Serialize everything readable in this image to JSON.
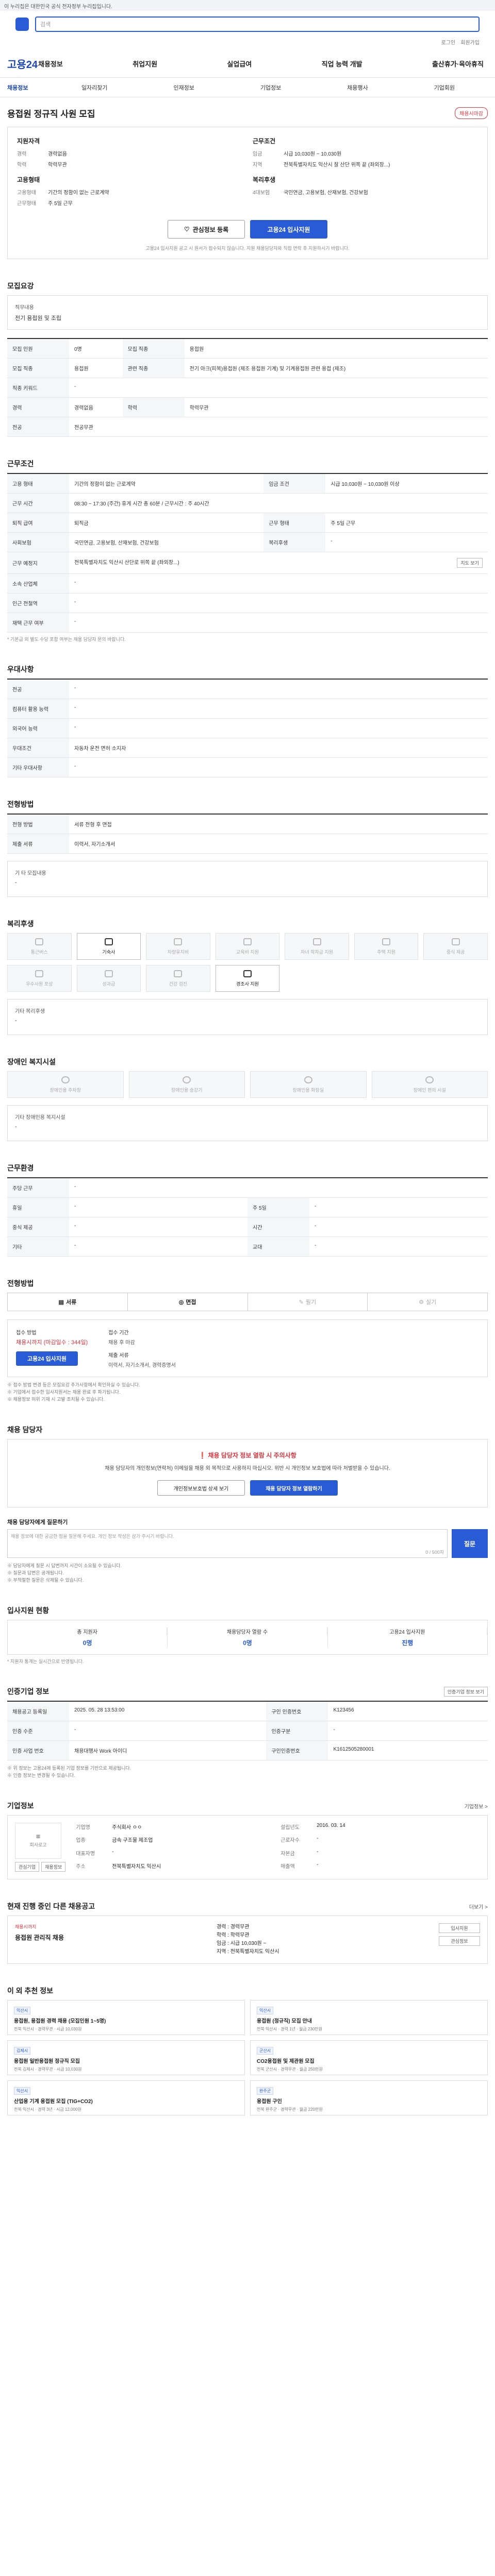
{
  "topbar": {
    "notice": "이 누리집은 대한민국 공식 전자정부 누리집입니다."
  },
  "search": {
    "placeholder": "검색"
  },
  "util": {
    "items": [
      "로그인",
      "회원가입"
    ]
  },
  "gnb": {
    "brand": "고용24",
    "menu": [
      "채용정보",
      "취업지원",
      "실업급여",
      "직업 능력 개발",
      "출산휴가·육아휴직"
    ]
  },
  "lnb": {
    "current": "채용정보",
    "items": [
      "일자리찾기",
      "인재정보",
      "기업정보",
      "채용행사",
      "기업회원"
    ]
  },
  "job": {
    "title": "용접원 정규직 사원 모집",
    "badge": "채용시마감"
  },
  "summary": {
    "left_title": "지원자격",
    "left": [
      {
        "k": "경력",
        "v": "경력없음"
      },
      {
        "k": "학력",
        "v": "학력무관"
      }
    ],
    "left2_title": "고용형태",
    "left2": [
      {
        "k": "고용형태",
        "v": "기간의 정함이 없는 근로계약"
      },
      {
        "k": "근무형태",
        "v": "주 5일 근무"
      }
    ],
    "right_title": "근무조건",
    "right": [
      {
        "k": "임금",
        "v": "시급 10,030원 ~ 10,030원"
      },
      {
        "k": "지역",
        "v": "전북특별자치도 익산시 잘 산단 위쪽 끝 (좌외장...)"
      }
    ],
    "right2_title": "복리후생",
    "right2": [
      {
        "k": "4대보험",
        "v": "국민연금, 고용보험, 산재보험, 건강보험"
      }
    ],
    "btn_scrap": "관심정보 등록",
    "btn_apply": "고용24 입사지원",
    "note": "고용24 입사지원 공고 시 원서가 접수되지 않습니다. 지원 채용담당자와 직접 연락 후 지원하시기 바랍니다."
  },
  "duty": {
    "title": "모집요강",
    "label": "직무내용",
    "value": "전기 용접원 및 조립"
  },
  "recruit": {
    "rows": [
      {
        "k1": "모집 인원",
        "v1": "0명",
        "k2": "모집 직종",
        "v2": "용접원"
      },
      {
        "k1": "모집 직종",
        "v1": "용접원",
        "k2": "관련 직종",
        "v2": "전기 아크(피복)용접원 (제조 용접원 기계) 및 기계용접원 관련 용접 (제조)"
      },
      {
        "k1": "직종 키워드",
        "v1": "-",
        "k2": "",
        "v2": ""
      },
      {
        "k1": "경력",
        "v1": "경력없음",
        "k2": "학력",
        "v2": "학력무관"
      },
      {
        "k1": "전공",
        "v1": "전공무관",
        "k2": "",
        "v2": ""
      }
    ]
  },
  "work": {
    "title": "근무조건",
    "rows": [
      {
        "k1": "고용 형태",
        "v1": "기간의 정함이 없는 근로계약",
        "k2": "임금 조건",
        "v2": "시급 10,030원 ~ 10,030원 이상"
      },
      {
        "k1": "근무 시간",
        "v1": "08:30 ~ 17:30 (주간) 휴게 시간 총 60분 / 근무시간 : 주 40시간",
        "k2": "",
        "v2": ""
      },
      {
        "k1": "퇴직 급여",
        "v1": "퇴직금",
        "k2": "근무 형태",
        "v2": "주 5일 근무"
      },
      {
        "k1": "사회보험",
        "v1": "국민연금, 고용보험, 산재보험, 건강보험",
        "k2": "복리후생",
        "v2": "-"
      },
      {
        "k1": "근무 예정지",
        "v1": "전북특별자치도 익산시 산단로 위쪽 끝 (좌외장...)",
        "k2": "",
        "v2": ""
      },
      {
        "k1": "소속 산업체",
        "v1": "-",
        "k2": "",
        "v2": ""
      },
      {
        "k1": "인근 전철역",
        "v1": "-",
        "k2": "",
        "v2": ""
      },
      {
        "k1": "재택 근무 여부",
        "v1": "-",
        "k2": "",
        "v2": ""
      }
    ],
    "map_btn": "지도 보기",
    "footnote": "* 기본급 외 별도 수당 포함 여부는 채용 담당자 문의 바랍니다."
  },
  "pref": {
    "title": "우대사항",
    "rows": [
      {
        "k": "전공",
        "v": "-"
      },
      {
        "k": "컴퓨터 활용 능력",
        "v": "-"
      },
      {
        "k": "외국어 능력",
        "v": "-"
      },
      {
        "k": "우대조건",
        "v": "자동차 운전 면허 소지자"
      },
      {
        "k": "기타 우대사항",
        "v": "-"
      }
    ]
  },
  "screen": {
    "title": "전형방법",
    "rows": [
      {
        "k": "전형 방법",
        "v": "서류 전형 후 면접"
      },
      {
        "k": "제출 서류",
        "v": "이력서, 자기소개서"
      }
    ],
    "etc_label": "기 타 모집내용",
    "etc_value": "-"
  },
  "welfare": {
    "title": "복리후생",
    "items": [
      {
        "label": "통근버스",
        "on": false
      },
      {
        "label": "기숙사",
        "on": true
      },
      {
        "label": "차량유지비",
        "on": false
      },
      {
        "label": "교육비 지원",
        "on": false
      },
      {
        "label": "자녀 학자금 지원",
        "on": false
      },
      {
        "label": "주택 지원",
        "on": false
      },
      {
        "label": "중식 제공",
        "on": false
      },
      {
        "label": "우수사원 포상",
        "on": false
      },
      {
        "label": "성과급",
        "on": false
      },
      {
        "label": "건강 검진",
        "on": false
      },
      {
        "label": "경조사 지원",
        "on": true
      }
    ],
    "etc_label": "기타 복리후생",
    "etc_value": "-"
  },
  "disabled": {
    "title": "장애인 복지시설",
    "items": [
      {
        "label": "장애인용 주차장"
      },
      {
        "label": "장애인용 승강기"
      },
      {
        "label": "장애인용 화장실"
      },
      {
        "label": "장애인 편의 시설"
      }
    ],
    "etc_label": "기타 장애인용 복지시설",
    "etc_value": "-"
  },
  "worktime": {
    "title": "근무환경",
    "rows": [
      {
        "k1": "주당 근무",
        "v1": "-",
        "k2": "",
        "v2": ""
      },
      {
        "k1": "휴일",
        "v1": "-",
        "k2": "주 5일",
        "v2": "-"
      },
      {
        "k1": "중식 제공",
        "v1": "-",
        "k2": "시간",
        "v2": "-"
      },
      {
        "k1": "기타",
        "v1": "-",
        "k2": "교대",
        "v2": "-"
      }
    ]
  },
  "apply": {
    "title": "전형방법",
    "tabs": [
      {
        "label": "서류",
        "on": true
      },
      {
        "label": "면접",
        "on": true
      },
      {
        "label": "필기",
        "on": false
      },
      {
        "label": "실기",
        "on": false
      }
    ],
    "method_label": "접수 방법",
    "method_value": "채용시까지 (마감일수 : 344일)",
    "method_btn": "고용24 입사지원",
    "period_label": "접수 기간",
    "period_value": "채용 후 마감",
    "docs_label": "제출 서류",
    "docs_value": "이력서, 자기소개서, 경력증명서",
    "bullets": [
      "※ 접수 방법 변경 등은 모집요강 추가사항에서 확인하실 수 있습니다.",
      "※ 기업에서 접수한 입사지원서는 채용 완료 후 파기됩니다.",
      "※ 채용정보 허위 기재 시 고발 조치될 수 있습니다."
    ]
  },
  "contact": {
    "title": "채용 담당자",
    "warn_title": "❗ 채용 담당자 정보 열람 시 주의사항",
    "warn_desc": "채용 담당자의 개인정보(연락처) 이메일을 채용 외 목적으로 사용하지 마십시오. 위반 시 개인정보 보호법에 따라 처벌받을 수 있습니다.",
    "btn1": "개인정보보호법 상세 보기",
    "btn2": "채용 담당자 정보 열람하기",
    "q_title": "채용 담당자에게 질문하기",
    "q_placeholder": "채용 정보에 대한 궁금한 점을 질문해 주세요. 개인 정보 작성은 삼가 주시기 바랍니다.",
    "q_count": "0 / 500자",
    "q_btn": "질문",
    "bullets": [
      "※ 담당자에게 질문 시 답변까지 시간이 소요될 수 있습니다.",
      "※ 질문과 답변은 공개됩니다.",
      "※ 부적절한 질문은 삭제될 수 있습니다."
    ]
  },
  "status": {
    "title": "입사지원 현황",
    "items": [
      {
        "l": "총 지원자",
        "v": "0명"
      },
      {
        "l": "채용담당자 열람 수",
        "v": "0명"
      },
      {
        "l": "고용24 입사지원",
        "v": "진행"
      }
    ],
    "note": "* 지원자 통계는 실시간으로 반영됩니다."
  },
  "info": {
    "title": "인증기업 정보",
    "btn": "인증기업 정보 보기",
    "rows": [
      {
        "k1": "채용공고 등록일",
        "v1": "2025. 05. 28 13:53:00",
        "k2": "구인 인증번호",
        "v2": "K123456"
      },
      {
        "k1": "인증 수준",
        "v1": "-",
        "k2": "인증구분",
        "v2": "-"
      },
      {
        "k1": "인증 사업 번호",
        "v1": "채용대행사 Work 아이디",
        "k2": "구인인증번호",
        "v2": "K1612505280001"
      }
    ],
    "bullets": [
      "※ 위 정보는 고용24에 등록된 기업 정보를 기반으로 제공됩니다.",
      "※ 인증 정보는 변경될 수 있습니다."
    ]
  },
  "company": {
    "title": "기업정보",
    "link": "기업정보 >",
    "logo_text": "회사로고",
    "btn_a": "관심기업",
    "btn_b": "채용정보",
    "rows": [
      {
        "k1": "기업명",
        "v1": "주식회사 ㅇㅇ",
        "k2": "설립년도",
        "v2": "2016. 03. 14"
      },
      {
        "k1": "업종",
        "v1": "금속 구조물 제조업",
        "k2": "근로자수",
        "v2": "-"
      },
      {
        "k1": "대표자명",
        "v1": "-",
        "k2": "자본금",
        "v2": "-"
      },
      {
        "k1": "주소",
        "v1": "전북특별자치도 익산시",
        "k2": "매출액",
        "v2": "-"
      }
    ]
  },
  "other": {
    "title": "현재 진행 중인 다른 채용공고",
    "more": "더보기 >",
    "job_tag": "채용시까지",
    "job_title": "용접원 관리직 채용",
    "meta": [
      "경력 : 경력무관",
      "학력 : 학력무관",
      "임금 : 시급 10,030원 ~",
      "지역 : 전북특별자치도 익산시"
    ],
    "btn1": "입사지원",
    "btn2": "관심정보"
  },
  "recent": {
    "title": "이 외 추천 정보",
    "cards": [
      {
        "tag": "익산시",
        "name": "용접원, 용접원 경력 채용 (모집인원 1~5명)",
        "meta": "전북 익산시 · 경력무관 · 시급 10,030원"
      },
      {
        "tag": "익산시",
        "name": "용접원 (정규직) 모집 안내",
        "meta": "전북 익산시 · 경력 1년 · 월급 230만원"
      },
      {
        "tag": "김제시",
        "name": "용접원 일반용접원 정규직 모집",
        "meta": "전북 김제시 · 경력무관 · 시급 10,030원"
      },
      {
        "tag": "군산시",
        "name": "CO2용접원 및 제관원 모집",
        "meta": "전북 군산시 · 경력무관 · 월급 250만원"
      },
      {
        "tag": "익산시",
        "name": "산업용 기계 용접원 모집 (TIG+CO2)",
        "meta": "전북 익산시 · 경력 3년 · 시급 12,000원"
      },
      {
        "tag": "완주군",
        "name": "용접원 구인",
        "meta": "전북 완주군 · 경력무관 · 월급 220만원"
      }
    ]
  }
}
